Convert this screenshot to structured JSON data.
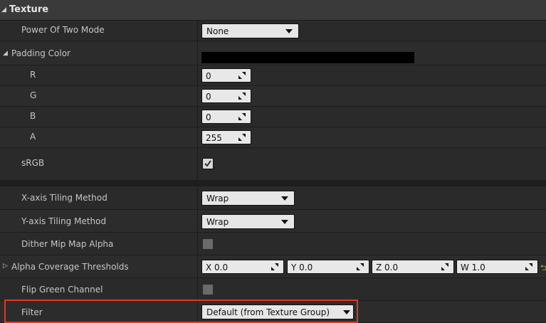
{
  "section": {
    "title": "Texture"
  },
  "rows": {
    "power_of_two": {
      "label": "Power Of Two Mode",
      "value": "None"
    },
    "padding_color": {
      "label": "Padding Color",
      "color": "#000000"
    },
    "r": {
      "label": "R",
      "value": "0"
    },
    "g": {
      "label": "G",
      "value": "0"
    },
    "b": {
      "label": "B",
      "value": "0"
    },
    "a": {
      "label": "A",
      "value": "255"
    },
    "srgb": {
      "label": "sRGB",
      "checked": true
    },
    "x_tiling": {
      "label": "X-axis Tiling Method",
      "value": "Wrap"
    },
    "y_tiling": {
      "label": "Y-axis Tiling Method",
      "value": "Wrap"
    },
    "dither": {
      "label": "Dither Mip Map Alpha",
      "checked": false
    },
    "alpha_coverage": {
      "label": "Alpha Coverage Thresholds",
      "x": "X 0.0",
      "y": "Y 0.0",
      "z": "Z 0.0",
      "w": "W 1.0"
    },
    "flip_green": {
      "label": "Flip Green Channel",
      "checked": false
    },
    "filter": {
      "label": "Filter",
      "value": "Default (from Texture Group)"
    }
  },
  "colors": {
    "highlight": "#e03a1e",
    "reset_arrow": "#d2b42a"
  }
}
